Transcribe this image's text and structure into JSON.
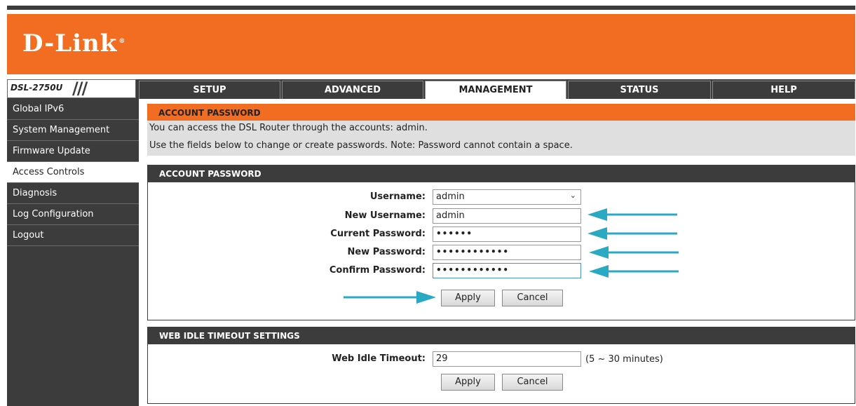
{
  "brand": {
    "logo_text": "D-Link",
    "model": "DSL-2750U"
  },
  "nav": {
    "tabs": [
      {
        "label": "SETUP",
        "active": false
      },
      {
        "label": "ADVANCED",
        "active": false
      },
      {
        "label": "MANAGEMENT",
        "active": true
      },
      {
        "label": "STATUS",
        "active": false
      },
      {
        "label": "HELP",
        "active": false
      }
    ]
  },
  "sidebar": {
    "items": [
      {
        "label": "Global IPv6",
        "active": false
      },
      {
        "label": "System Management",
        "active": false
      },
      {
        "label": "Firmware Update",
        "active": false
      },
      {
        "label": "Access Controls",
        "active": true
      },
      {
        "label": "Diagnosis",
        "active": false
      },
      {
        "label": "Log Configuration",
        "active": false
      },
      {
        "label": "Logout",
        "active": false
      }
    ]
  },
  "intro": {
    "title": "ACCOUNT PASSWORD",
    "line1": "You can access the DSL Router through the accounts: admin.",
    "line2": "Use the fields below to change or create passwords. Note: Password cannot contain a space."
  },
  "account_form": {
    "title": "ACCOUNT PASSWORD",
    "username_label": "Username:",
    "username_value": "admin",
    "new_username_label": "New Username:",
    "new_username_value": "admin",
    "current_password_label": "Current Password:",
    "current_password_value": "••••••",
    "new_password_label": "New Password:",
    "new_password_value": "••••••••••••",
    "confirm_password_label": "Confirm Password:",
    "confirm_password_value": "••••••••••••",
    "apply_label": "Apply",
    "cancel_label": "Cancel"
  },
  "idle_form": {
    "title": "WEB IDLE TIMEOUT SETTINGS",
    "timeout_label": "Web Idle Timeout:",
    "timeout_value": "29",
    "timeout_hint": "(5 ~ 30 minutes)",
    "apply_label": "Apply",
    "cancel_label": "Cancel"
  },
  "colors": {
    "brand_orange": "#f26d21",
    "dark_gray": "#3c3c3c",
    "arrow_teal": "#29a9c4"
  },
  "icons": {
    "select_chevron": "chevron-down-icon",
    "annotation_arrow": "arrow-left-icon"
  }
}
